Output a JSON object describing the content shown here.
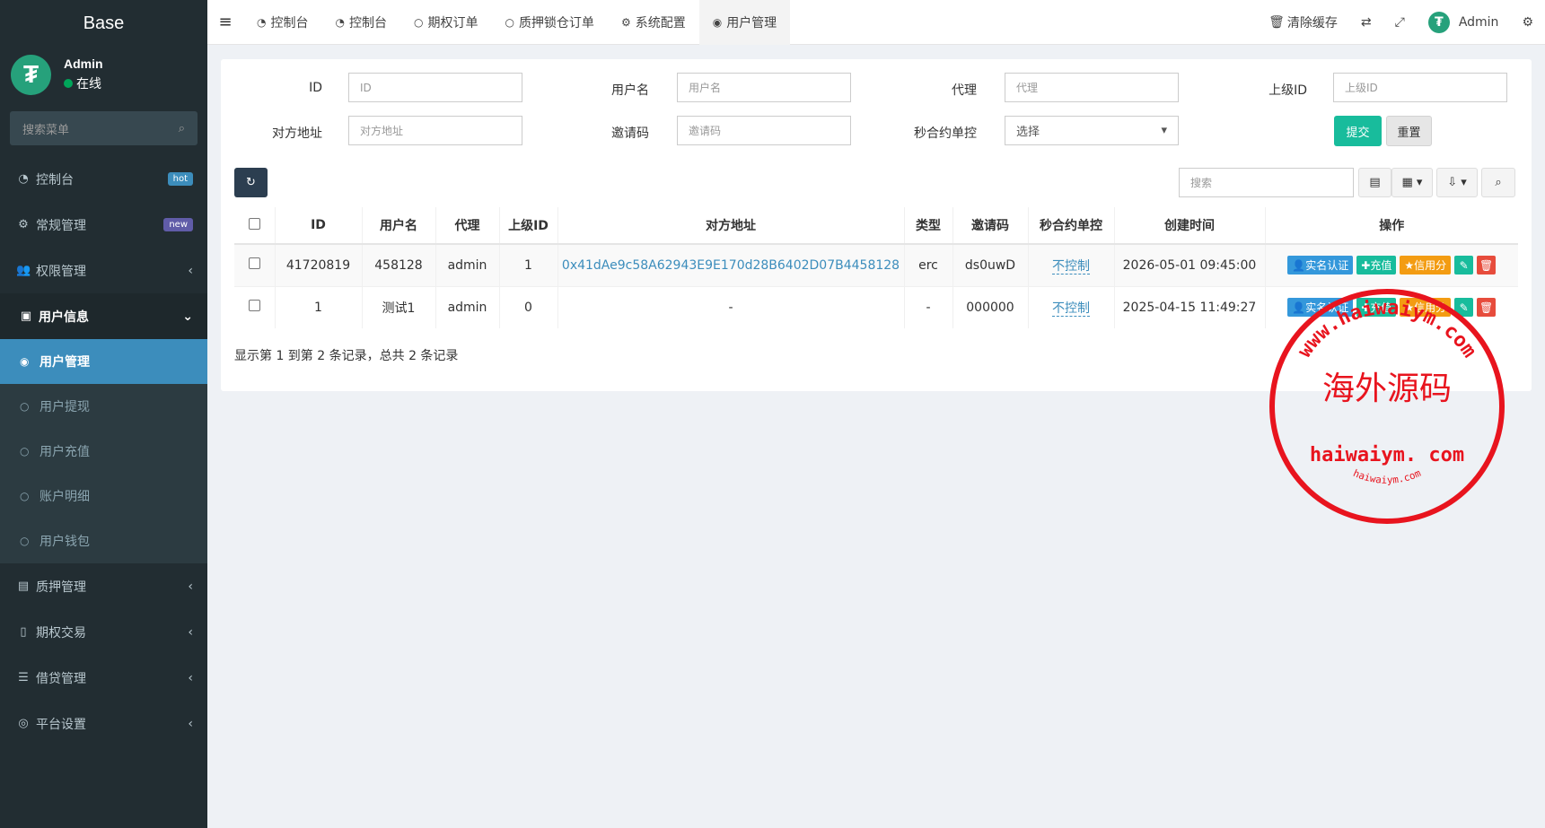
{
  "sidebar": {
    "brand": "Base",
    "user": {
      "name": "Admin",
      "status": "在线"
    },
    "search_placeholder": "搜索菜单",
    "menu": [
      {
        "label": "控制台",
        "badge": "hot",
        "badge_color": "#3c8dbc"
      },
      {
        "label": "常规管理",
        "badge": "new",
        "badge_color": "#605ca8"
      },
      {
        "label": "权限管理"
      },
      {
        "label": "用户信息"
      },
      {
        "label": "质押管理"
      },
      {
        "label": "期权交易"
      },
      {
        "label": "借贷管理"
      },
      {
        "label": "平台设置"
      }
    ],
    "submenu": [
      {
        "label": "用户管理"
      },
      {
        "label": "用户提现"
      },
      {
        "label": "用户充值"
      },
      {
        "label": "账户明细"
      },
      {
        "label": "用户钱包"
      }
    ]
  },
  "topbar": {
    "tabs": [
      {
        "label": "控制台"
      },
      {
        "label": "控制台"
      },
      {
        "label": "期权订单"
      },
      {
        "label": "质押锁仓订单"
      },
      {
        "label": "系统配置"
      },
      {
        "label": "用户管理"
      }
    ],
    "clear_cache": "清除缓存",
    "admin": "Admin"
  },
  "filters": {
    "id_label": "ID",
    "id_placeholder": "ID",
    "username_label": "用户名",
    "username_placeholder": "用户名",
    "agent_label": "代理",
    "agent_placeholder": "代理",
    "parent_label": "上级ID",
    "parent_placeholder": "上级ID",
    "address_label": "对方地址",
    "address_placeholder": "对方地址",
    "invite_label": "邀请码",
    "invite_placeholder": "邀请码",
    "control_label": "秒合约单控",
    "control_value": "选择",
    "submit": "提交",
    "reset": "重置"
  },
  "toolbar": {
    "search_placeholder": "搜索"
  },
  "table": {
    "headers": [
      "ID",
      "用户名",
      "代理",
      "上级ID",
      "对方地址",
      "类型",
      "邀请码",
      "秒合约单控",
      "创建时间",
      "操作"
    ],
    "rows": [
      {
        "id": "41720819",
        "username": "458128",
        "agent": "admin",
        "parent": "1",
        "address": "0x41dAe9c58A62943E9E170d28B6402D07B4458128",
        "type": "erc",
        "invite": "ds0uwD",
        "control": "不控制",
        "created": "2026-05-01 09:45:00"
      },
      {
        "id": "1",
        "username": "测试1",
        "agent": "admin",
        "parent": "0",
        "address": "-",
        "type": "-",
        "invite": "000000",
        "control": "不控制",
        "created": "2025-04-15 11:49:27"
      }
    ],
    "actions": {
      "verify": "实名认证",
      "recharge": "充值",
      "credit": "信用分"
    }
  },
  "pagination": "显示第 1 到第 2 条记录，总共 2 条记录",
  "watermark": {
    "center": "海外源码",
    "bottom": "haiwaiym. com",
    "ring_top": "www.haiwaiym.com",
    "ring_bottom": "haiwaiym.com"
  }
}
